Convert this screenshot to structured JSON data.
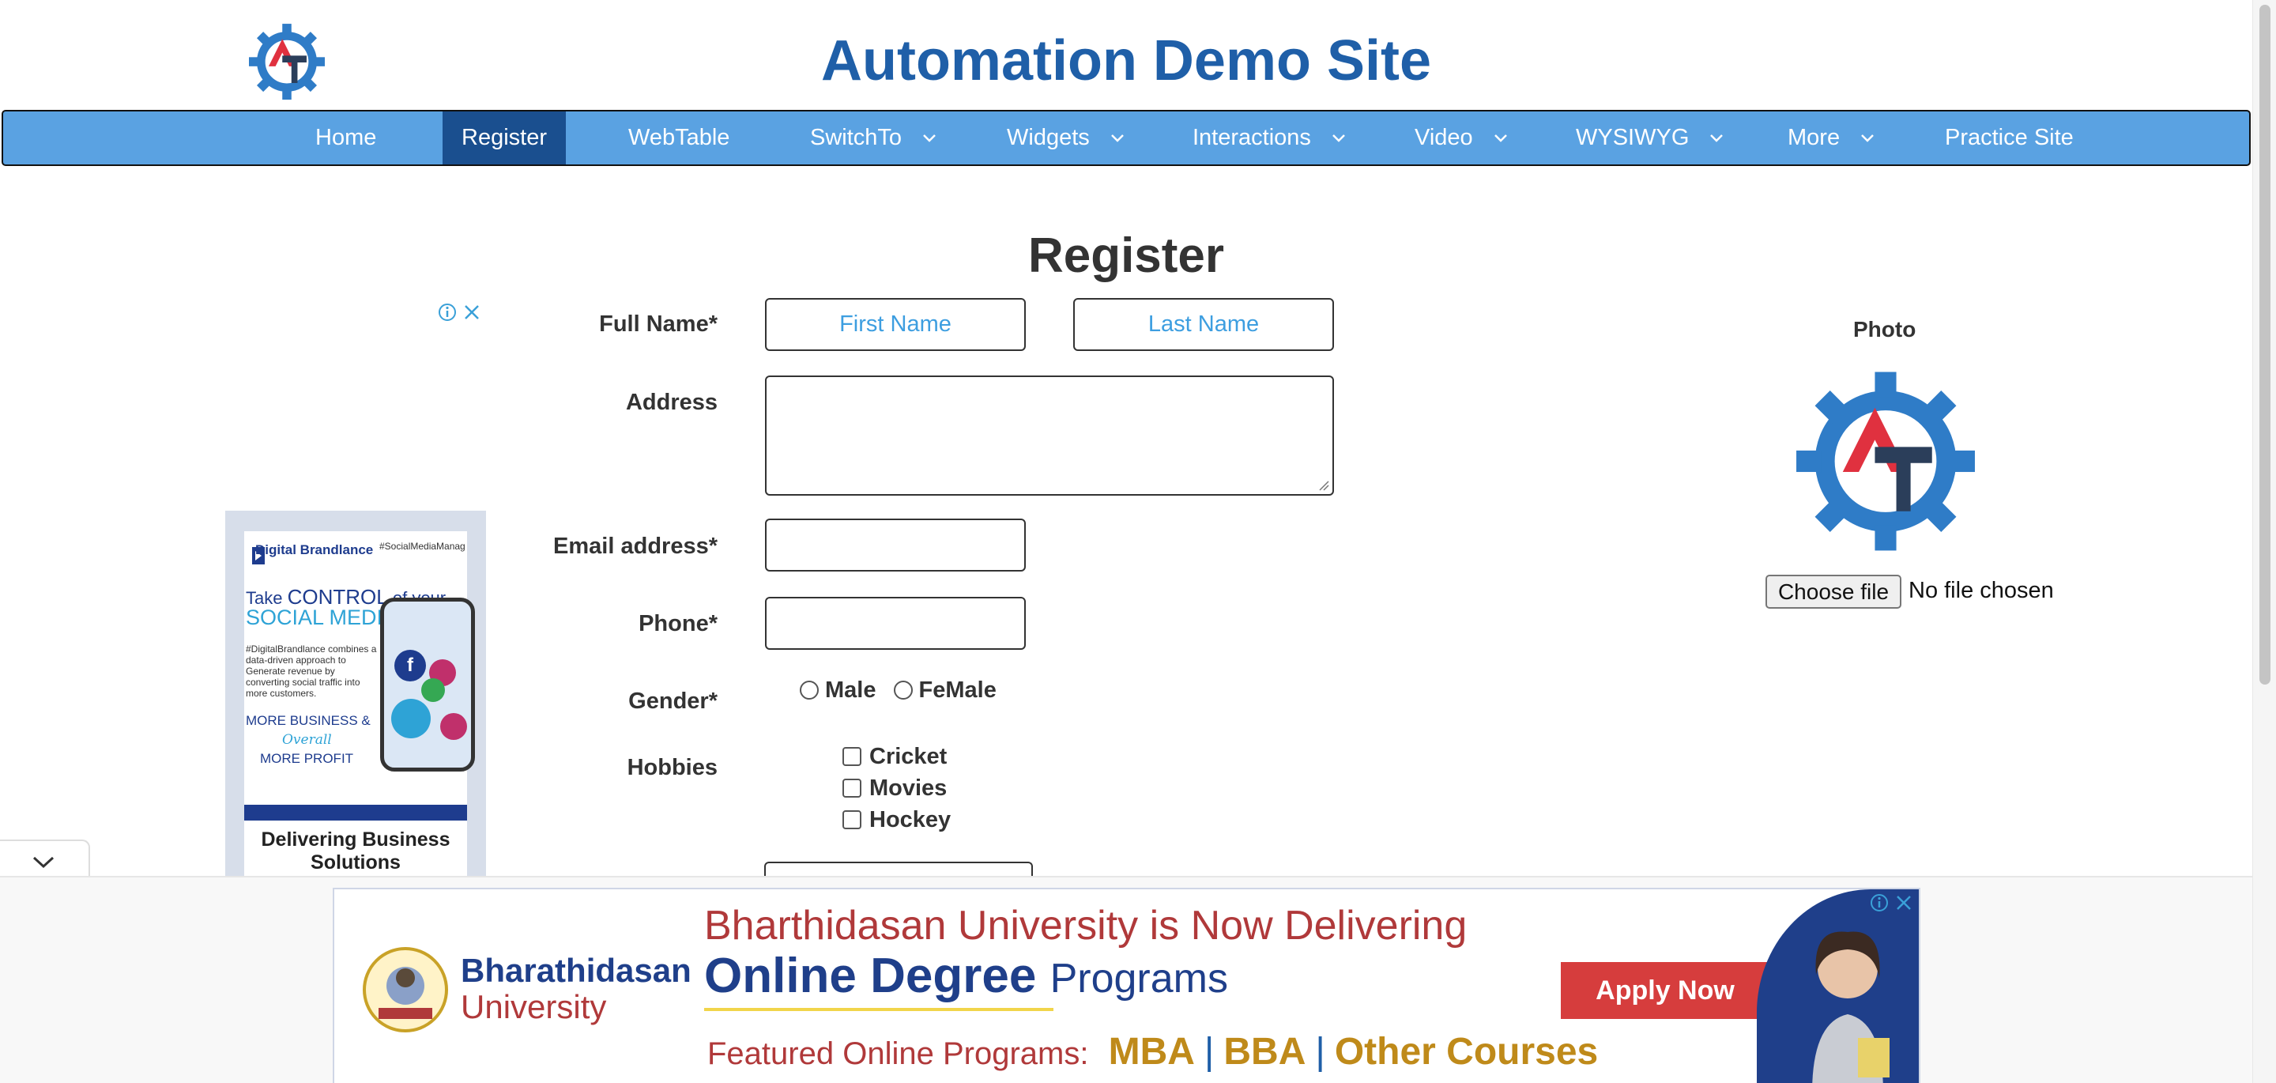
{
  "header": {
    "site_title": "Automation Demo Site",
    "logo_letters": {
      "a": "A",
      "t": "T"
    }
  },
  "nav": {
    "items": [
      {
        "label": "Home",
        "dropdown": false
      },
      {
        "label": "Register",
        "dropdown": false,
        "active": true
      },
      {
        "label": "WebTable",
        "dropdown": false
      },
      {
        "label": "SwitchTo",
        "dropdown": true
      },
      {
        "label": "Widgets",
        "dropdown": true
      },
      {
        "label": "Interactions",
        "dropdown": true
      },
      {
        "label": "Video",
        "dropdown": true
      },
      {
        "label": "WYSIWYG",
        "dropdown": true
      },
      {
        "label": "More",
        "dropdown": true
      },
      {
        "label": "Practice Site",
        "dropdown": false
      }
    ]
  },
  "form": {
    "heading": "Register",
    "full_name_label": "Full Name*",
    "first_name_placeholder": "First Name",
    "last_name_placeholder": "Last Name",
    "address_label": "Address",
    "email_label": "Email address*",
    "phone_label": "Phone*",
    "gender_label": "Gender*",
    "gender_options": [
      "Male",
      "FeMale"
    ],
    "hobbies_label": "Hobbies",
    "hobbies": [
      "Cricket",
      "Movies",
      "Hockey"
    ]
  },
  "photo": {
    "label": "Photo",
    "choose_button": "Choose file",
    "status": "No file chosen"
  },
  "side_ad": {
    "brand": "Digital Brandlance",
    "hashtag": "#SocialMediaManag",
    "take": "Take",
    "control": "CONTROL",
    "of_your": "of your",
    "social_media": "SOCIAL MEDIA",
    "body": "#DigitalBrandlance combines a data-driven approach to Generate revenue by converting social traffic into more customers.",
    "more_business": "MORE BUSINESS &",
    "overall": "Overall",
    "more_profit": "MORE PROFIT",
    "footer": "Delivering Business Solutions"
  },
  "bottom_ad": {
    "university_line1": "Bharathidasan",
    "university_line2": "University",
    "headline": "Bharthidasan University is Now Delivering",
    "online_degree": "Online Degree",
    "programs": "Programs",
    "featured": "Featured Online Programs:",
    "programs_list": [
      "MBA",
      "BBA",
      "Other Courses"
    ],
    "separator": "|",
    "cta": "Apply Now"
  },
  "colors": {
    "nav_bg": "#5aa2e2",
    "nav_active": "#1a4f8f",
    "title_blue": "#1f5fa8",
    "placeholder_blue": "#3d9ee0",
    "logo_red": "#e0313f",
    "logo_navy": "#2b3e5a"
  },
  "icons": {
    "dropdown": "chevron-down-icon",
    "ad_info": "info-icon",
    "ad_close": "close-icon",
    "collapse": "chevron-down-icon"
  }
}
